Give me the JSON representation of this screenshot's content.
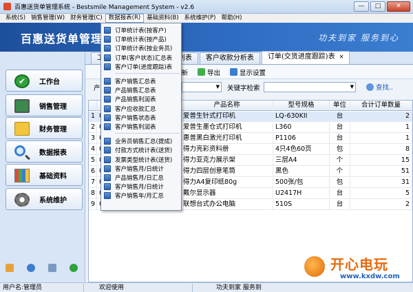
{
  "window": {
    "title": "百惠送货单管理系统 - Bestsmile Management System - v2.6",
    "min": "—",
    "max": "□",
    "close": "✕"
  },
  "menubar": [
    {
      "label": "系统(S)"
    },
    {
      "label": "销售管理(W)"
    },
    {
      "label": "财务管理(C)"
    },
    {
      "label": "数据报表(R)",
      "active": true
    },
    {
      "label": "基础资料(B)"
    },
    {
      "label": "系统维护(P)"
    },
    {
      "label": "帮助(H)"
    }
  ],
  "banner": {
    "title": "百惠送货单管理",
    "slogan": "功夫到家  服务到心"
  },
  "sidebar": [
    {
      "label": "工作台",
      "icon": "check-icon"
    },
    {
      "label": "销售管理",
      "icon": "monitor-icon"
    },
    {
      "label": "财务管理",
      "icon": "folder-icon"
    },
    {
      "label": "数据报表",
      "icon": "magnifier-icon"
    },
    {
      "label": "基础资料",
      "icon": "chart-icon"
    },
    {
      "label": "系统维护",
      "icon": "gear-icon"
    }
  ],
  "tabs": [
    {
      "label": "工"
    },
    {
      "label": ")列表"
    },
    {
      "label": "客户收款分析表"
    },
    {
      "label": "订单(交货进度跟踪)表",
      "active": true,
      "close": "✕"
    }
  ],
  "toolbar": {
    "refresh": "刷新",
    "export": "导出",
    "display_settings": "显示设置"
  },
  "filter": {
    "product_label": "产",
    "keyword_label": "关键字检索",
    "find": "查找.."
  },
  "grid": {
    "columns": [
      "",
      "码",
      "产品名称",
      "型号规格",
      "单位",
      "合计订单数量"
    ],
    "rows": [
      {
        "no": "1",
        "code": "01001",
        "name": "爱普生针式打印机",
        "spec": "LQ-630KII",
        "unit": "台",
        "qty": "2"
      },
      {
        "no": "2",
        "code": "01002",
        "name": "爱普生墨仓式打印机",
        "spec": "L360",
        "unit": "台",
        "qty": "1"
      },
      {
        "no": "3",
        "code": "01003",
        "name": "惠普黑白激光打印机",
        "spec": "P1106",
        "unit": "台",
        "qty": "1"
      },
      {
        "no": "4",
        "code": "01005",
        "name": "得力亮彩资料册",
        "spec": "4只4色60页",
        "unit": "包",
        "qty": "8"
      },
      {
        "no": "5",
        "code": "01006",
        "name": "得力亚克力展示架",
        "spec": "三层A4",
        "unit": "个",
        "qty": "15"
      },
      {
        "no": "6",
        "code": "01007",
        "name": "得力四层创意笔筒",
        "spec": "黑色",
        "unit": "个",
        "qty": "51"
      },
      {
        "no": "7",
        "code": "01008",
        "name": "得力A4复印纸80g",
        "spec": "500张/包",
        "unit": "包",
        "qty": "31"
      },
      {
        "no": "8",
        "code": "01009",
        "name": "戴尔显示器",
        "spec": "U2417H",
        "unit": "台",
        "qty": "5"
      },
      {
        "no": "9",
        "code": "01010",
        "name": "联想台式办公电脑",
        "spec": "510S",
        "unit": "台",
        "qty": "2"
      }
    ]
  },
  "report_menu": [
    {
      "label": "订单统计表(按客户)"
    },
    {
      "label": "订单统计表(按产品)"
    },
    {
      "label": "订单统计表(按业务员)"
    },
    {
      "label": "订单(客户状态)汇总表"
    },
    {
      "label": "客户订单(进度跟踪)表"
    },
    {
      "sep": true
    },
    {
      "label": "客户销售汇总表"
    },
    {
      "label": "产品销售汇总表"
    },
    {
      "label": "产品销售利润表"
    },
    {
      "label": "客户应收款汇总"
    },
    {
      "label": "客户销售状态表"
    },
    {
      "label": "客户销售利润表"
    },
    {
      "sep": true
    },
    {
      "label": "业务员销售汇总(提成)"
    },
    {
      "label": "付款方式统计表(送货)"
    },
    {
      "label": "发票类型统计表(送货)"
    },
    {
      "label": "客户销售月/日统计"
    },
    {
      "label": "产品销售月/日汇总"
    },
    {
      "label": "客户销售月/日统计"
    },
    {
      "label": "客户销售年/月汇总"
    }
  ],
  "status": {
    "user": "用户名:管理员",
    "welcome": "欢迎使用",
    "slogan": "功夫到家 服务到"
  },
  "watermark": {
    "text": "开心电玩",
    "url": "www.kxdw.com"
  }
}
